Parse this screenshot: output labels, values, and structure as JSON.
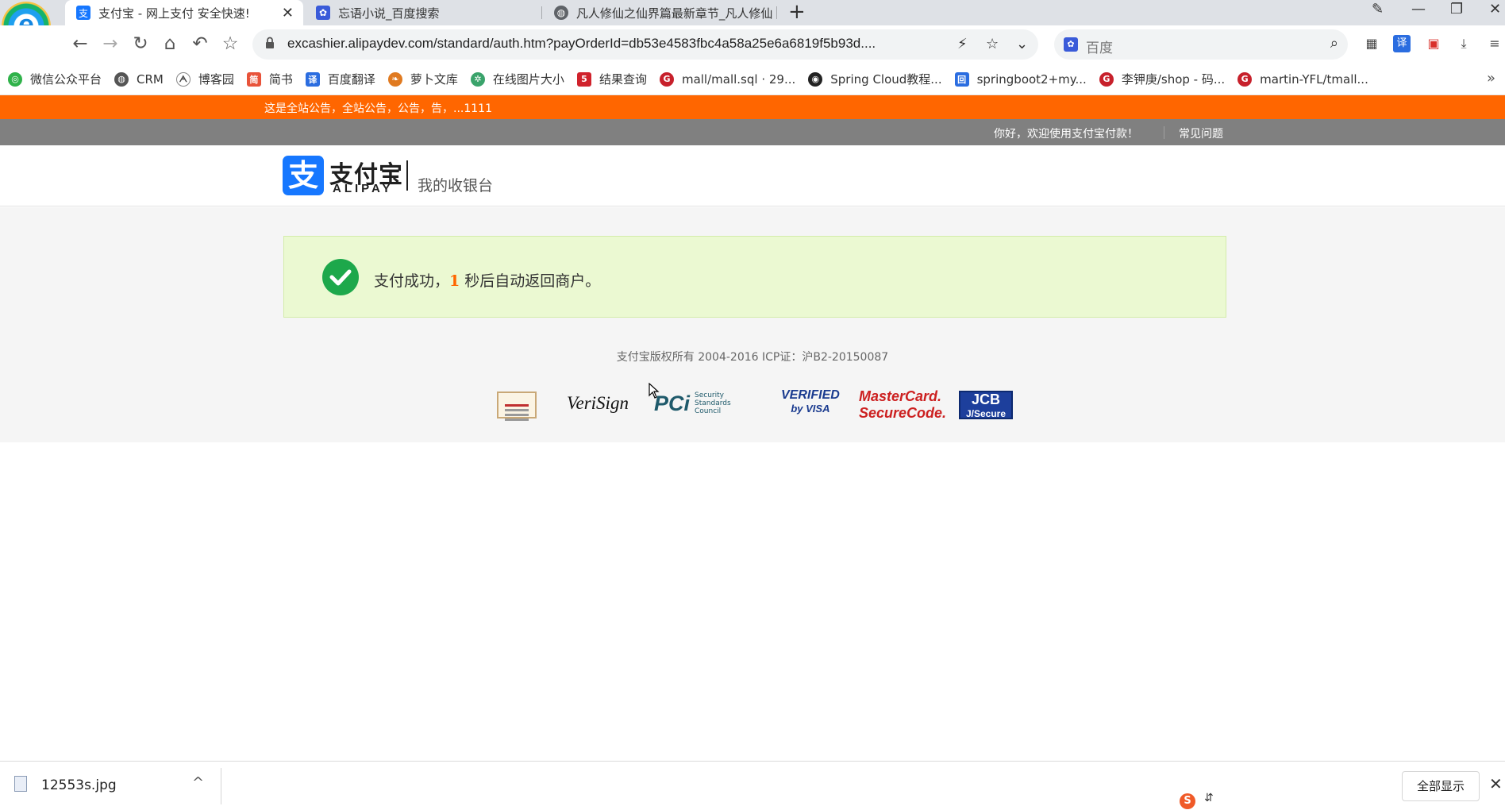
{
  "browser": {
    "logo_letter": "e",
    "tabs": [
      {
        "label": "支付宝 - 网上支付 安全快速!",
        "icon": "alipay-icon",
        "active": true
      },
      {
        "label": "忘语小说_百度搜索",
        "icon": "baidu-paw-icon",
        "active": false
      },
      {
        "label": "凡人修仙之仙界篇最新章节_凡人修仙",
        "icon": "globe-icon",
        "active": false
      }
    ],
    "close_glyph": "✕",
    "new_tab_glyph": "+",
    "window_controls": {
      "minimize": "—",
      "restore": "❐",
      "close": "✕",
      "extra": "✎"
    },
    "url": "excashier.alipaydev.com/standard/auth.htm?payOrderId=db53e4583fbc4a58a25e6a6819f5b93d....",
    "search_placeholder": "百度",
    "bookmarks": [
      {
        "label": "微信公众平台",
        "color": "#2fb24a"
      },
      {
        "label": "CRM",
        "color": "#555555"
      },
      {
        "label": "博客园",
        "color": "#444444"
      },
      {
        "label": "简书",
        "color": "#e8533a"
      },
      {
        "label": "百度翻译",
        "color": "#2b6de0"
      },
      {
        "label": "萝卜文库",
        "color": "#e07a20"
      },
      {
        "label": "在线图片大小",
        "color": "#3aa36b"
      },
      {
        "label": "结果查询",
        "color": "#d0222c"
      },
      {
        "label": "mall/mall.sql · 29...",
        "color": "#c7202b"
      },
      {
        "label": "Spring Cloud教程...",
        "color": "#222222"
      },
      {
        "label": "springboot2+my...",
        "color": "#2b6de0"
      },
      {
        "label": "李钾庚/shop - 码...",
        "color": "#c7202b"
      },
      {
        "label": "martin-YFL/tmall...",
        "color": "#c7202b"
      }
    ],
    "bookmarks_more": "»"
  },
  "page": {
    "notice": "这是全站公告，全站公告，公告，告，...1111",
    "welcome": "你好，欢迎使用支付宝付款！",
    "faq": "常见问题",
    "logo": {
      "mark": "支",
      "cn": "支付宝",
      "en": "ALIPAY"
    },
    "cashier_title": "我的收银台",
    "success": {
      "prefix": "支付成功，",
      "count": "1",
      "suffix": " 秒后自动返回商户。"
    },
    "copyright": "支付宝版权所有 2004-2016 ICP证：沪B2-20150087",
    "badges": {
      "verisign": "VeriSign",
      "pci": "PCi",
      "pci_sub": "Security Standards Council",
      "visa_1": "VERIFIED",
      "visa_2": "by VISA",
      "mc_1": "MasterCard.",
      "mc_2": "SecureCode.",
      "jcb_1": "JCB",
      "jcb_2": "J/Secure"
    },
    "colors": {
      "notice_bg": "#ff6600",
      "alipay_blue": "#1677ff",
      "success_green": "#1da84b"
    }
  },
  "downloads": {
    "file_name": "12553s.jpg",
    "show_all": "全部显示",
    "close_glyph": "✕",
    "chevron": "^"
  }
}
